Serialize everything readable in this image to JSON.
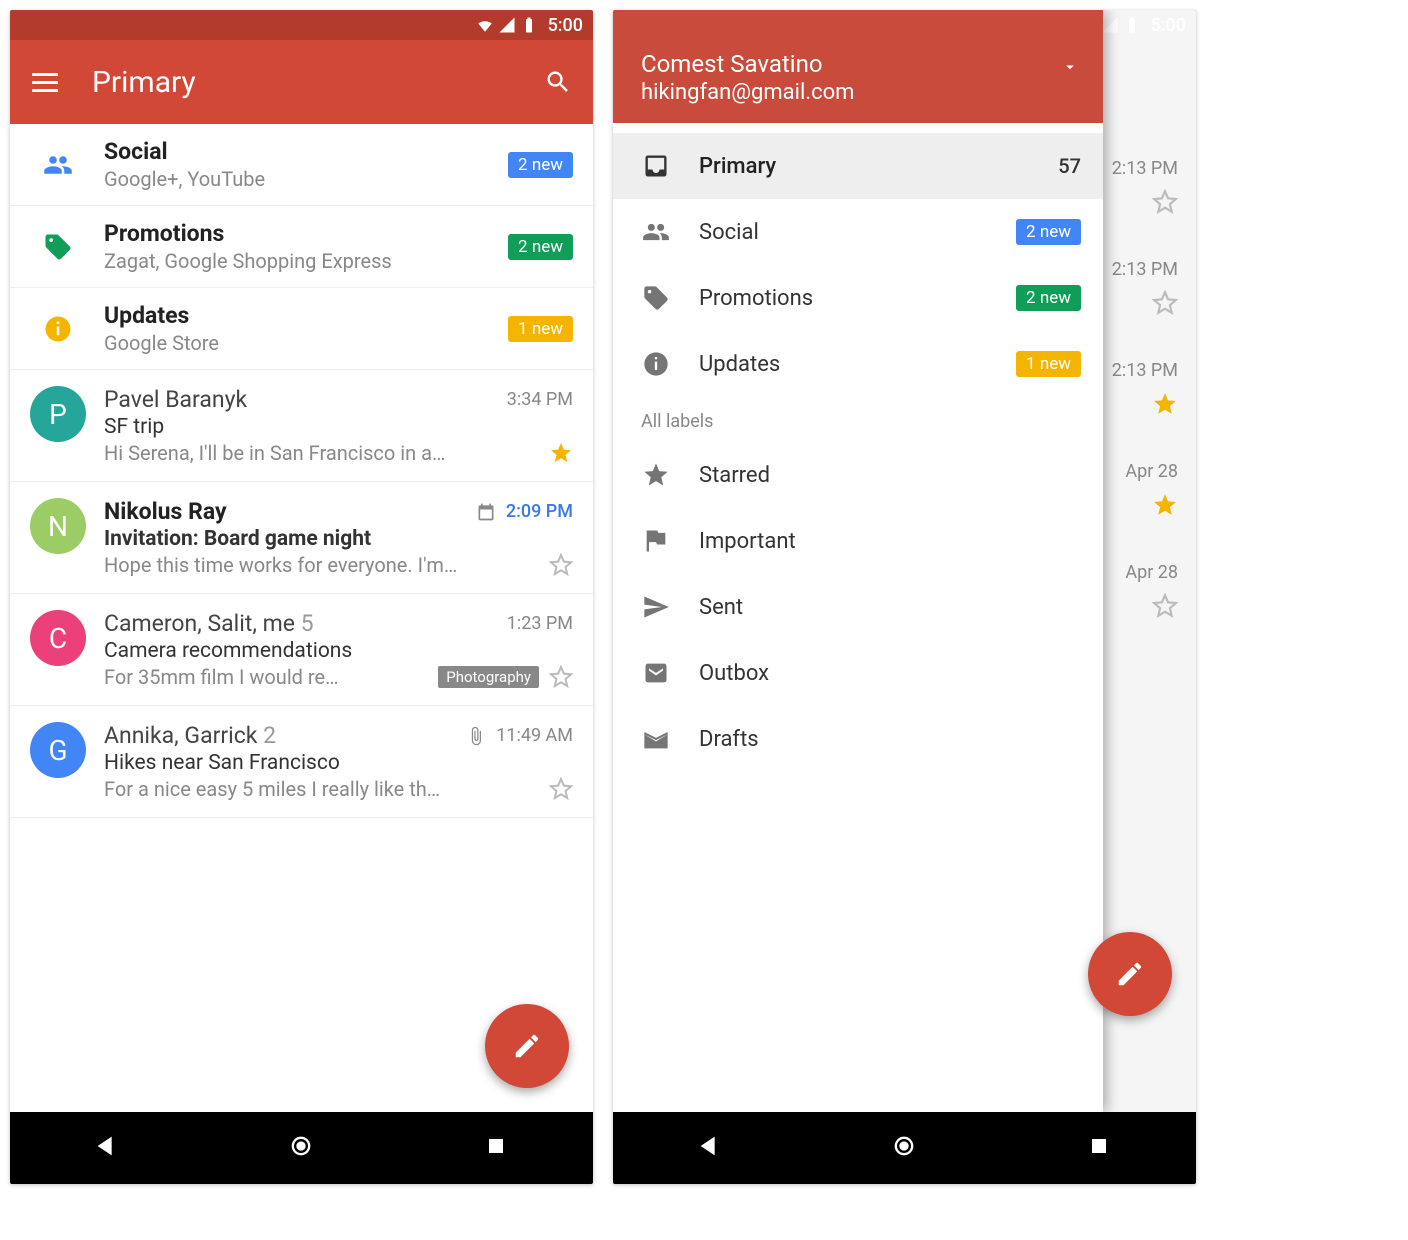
{
  "status": {
    "time": "5:00"
  },
  "left": {
    "title": "Primary",
    "categories": [
      {
        "icon": "social",
        "title": "Social",
        "sub": "Google+, YouTube",
        "badge": "2 new",
        "badgeColor": "blue"
      },
      {
        "icon": "promotions",
        "title": "Promotions",
        "sub": "Zagat, Google Shopping Express",
        "badge": "2 new",
        "badgeColor": "green"
      },
      {
        "icon": "updates",
        "title": "Updates",
        "sub": "Google Store",
        "badge": "1 new",
        "badgeColor": "yellow"
      }
    ],
    "emails": [
      {
        "avatarLetter": "P",
        "avatarColor": "#26a69a",
        "sender": "Pavel Baranyk",
        "threadCount": "",
        "subject": "SF trip",
        "snippet": "Hi Serena, I'll be in San Francisco in a…",
        "time": "3:34 PM",
        "unread": false,
        "starred": true,
        "tag": "",
        "calendarIcon": false,
        "attachIcon": false,
        "tsBlue": false
      },
      {
        "avatarLetter": "N",
        "avatarColor": "#9ccc65",
        "sender": "Nikolus Ray",
        "threadCount": "",
        "subject": "Invitation: Board game night",
        "snippet": "Hope this time works for everyone. I'm…",
        "time": "2:09 PM",
        "unread": true,
        "starred": false,
        "tag": "",
        "calendarIcon": true,
        "attachIcon": false,
        "tsBlue": true
      },
      {
        "avatarLetter": "C",
        "avatarColor": "#ec407a",
        "sender": "Cameron, Salit, me",
        "threadCount": "5",
        "subject": "Camera recommendations",
        "snippet": "For 35mm film I would re…",
        "time": "1:23 PM",
        "unread": false,
        "starred": false,
        "tag": "Photography",
        "calendarIcon": false,
        "attachIcon": false,
        "tsBlue": false
      },
      {
        "avatarLetter": "G",
        "avatarColor": "#4285f4",
        "sender": "Annika, Garrick",
        "threadCount": "2",
        "subject": "Hikes near San Francisco",
        "snippet": "For a nice easy 5 miles I really like th…",
        "time": "11:49 AM",
        "unread": false,
        "starred": false,
        "tag": "",
        "calendarIcon": false,
        "attachIcon": true,
        "tsBlue": false
      }
    ]
  },
  "right": {
    "account": {
      "name": "Comest Savatino",
      "email": "hikingfan@gmail.com"
    },
    "drawer": {
      "categories": [
        {
          "icon": "inbox",
          "label": "Primary",
          "count": "57",
          "badgeColor": "",
          "active": true
        },
        {
          "icon": "social",
          "label": "Social",
          "count": "2 new",
          "badgeColor": "blue",
          "active": false
        },
        {
          "icon": "promotions",
          "label": "Promotions",
          "count": "2 new",
          "badgeColor": "green",
          "active": false
        },
        {
          "icon": "updates",
          "label": "Updates",
          "count": "1 new",
          "badgeColor": "yellow",
          "active": false
        }
      ],
      "sectionLabel": "All labels",
      "labels": [
        {
          "icon": "star",
          "label": "Starred"
        },
        {
          "icon": "flag",
          "label": "Important"
        },
        {
          "icon": "send",
          "label": "Sent"
        },
        {
          "icon": "outbox",
          "label": "Outbox"
        },
        {
          "icon": "drafts",
          "label": "Drafts"
        }
      ]
    },
    "backgroundRows": [
      {
        "time": "2:13 PM",
        "starred": false
      },
      {
        "time": "2:13 PM",
        "starred": false
      },
      {
        "time": "2:13 PM",
        "starred": true
      },
      {
        "time": "Apr 28",
        "starred": true
      },
      {
        "time": "Apr 28",
        "starred": false
      }
    ]
  }
}
